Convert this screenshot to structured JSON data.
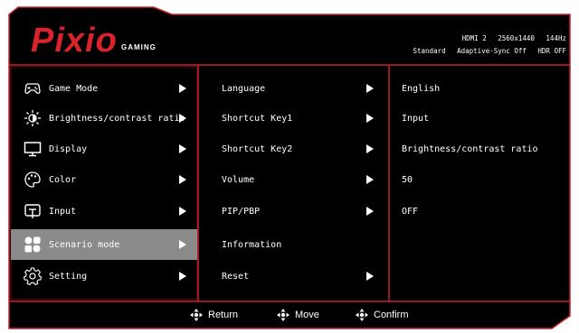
{
  "brand": {
    "logo": "Pixio",
    "sub": "GAMING"
  },
  "status": {
    "row1": [
      "HDMI 2",
      "2560x1440",
      "144Hz"
    ],
    "row2": [
      "Standard",
      "Adaptive-Sync Off",
      "HDR OFF"
    ]
  },
  "menu": [
    {
      "label": "Game Mode",
      "icon": "gamepad-icon"
    },
    {
      "label": "Brightness/contrast ratio",
      "icon": "brightness-icon"
    },
    {
      "label": "Display",
      "icon": "monitor-icon"
    },
    {
      "label": "Color",
      "icon": "palette-icon"
    },
    {
      "label": "Input",
      "icon": "input-icon"
    },
    {
      "label": "Scenario mode",
      "icon": "scenario-icon",
      "selected": true
    },
    {
      "label": "Setting",
      "icon": "gear-icon"
    }
  ],
  "submenu": [
    {
      "label": "Language",
      "arrow": true
    },
    {
      "label": "Shortcut Key1",
      "arrow": true
    },
    {
      "label": "Shortcut Key2",
      "arrow": true
    },
    {
      "label": "Volume",
      "arrow": true
    },
    {
      "label": "PIP/PBP",
      "arrow": true
    },
    {
      "label": "Information",
      "arrow": false
    },
    {
      "label": "Reset",
      "arrow": true
    }
  ],
  "values": [
    "English",
    "Input",
    "Brightness/contrast ratio",
    "50",
    "OFF"
  ],
  "footer": {
    "return": "Return",
    "move": "Move",
    "confirm": "Confirm"
  },
  "colors": {
    "accent": "#d8232a",
    "bg": "#000000",
    "selected": "#8a8a8a"
  }
}
